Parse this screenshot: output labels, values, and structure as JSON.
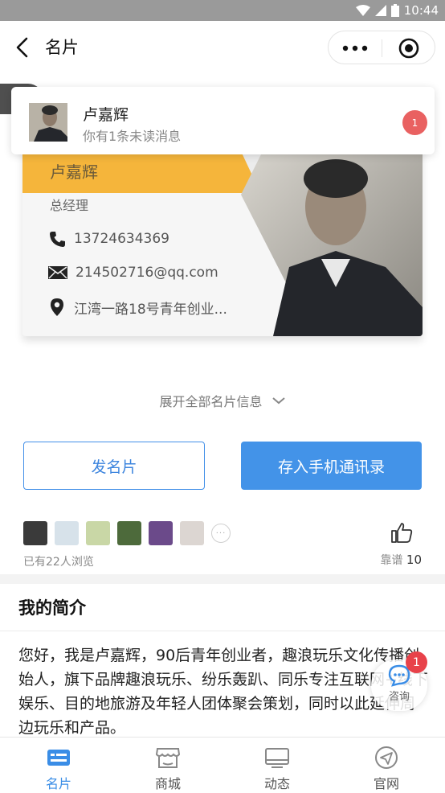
{
  "status_bar": {
    "time": "10:44"
  },
  "nav": {
    "title": "名片"
  },
  "notification": {
    "name": "卢嘉辉",
    "message": "你有1条未读消息",
    "badge": "1"
  },
  "card": {
    "name": "卢嘉辉",
    "title": "总经理",
    "phone": "13724634369",
    "email": "214502716@qq.com",
    "address": "江湾一路18号青年创业..."
  },
  "expand_label": "展开全部名片信息",
  "actions": {
    "send_card": "发名片",
    "save_contact": "存入手机通讯录"
  },
  "visitors": {
    "count_text": "已有22人浏览"
  },
  "like": {
    "label": "靠谱",
    "count": "10"
  },
  "intro": {
    "title": "我的简介",
    "text": "您好，我是卢嘉辉，90后青年创业者，趣浪玩乐文化传播创始人，旗下品牌趣浪玩乐、纷乐轰趴、同乐专注互联网+线下娱乐、目的地旅游及年轻人团体聚会策划，同时以此延伸周边玩乐和产品。"
  },
  "consult": {
    "label": "咨询",
    "badge": "1"
  },
  "tabs": [
    {
      "label": "名片",
      "icon": "card-icon",
      "active": true
    },
    {
      "label": "商城",
      "icon": "store-icon",
      "active": false
    },
    {
      "label": "动态",
      "icon": "monitor-icon",
      "active": false
    },
    {
      "label": "官网",
      "icon": "send-icon",
      "active": false
    }
  ],
  "colors": {
    "accent": "#4393e8",
    "card_bar": "#f5b53b",
    "badge": "#e8424a"
  }
}
